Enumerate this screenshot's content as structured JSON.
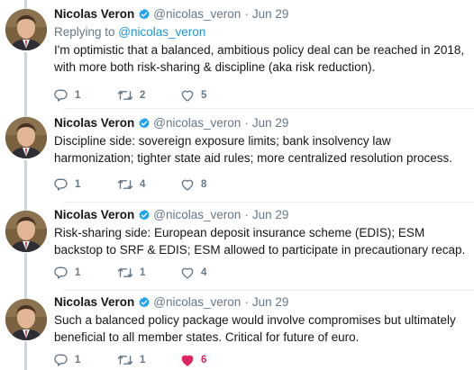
{
  "tweets": [
    {
      "name": "Nicolas Veron",
      "handle": "@nicolas_veron",
      "date": "Jun 29",
      "replying_prefix": "Replying to ",
      "replying_to": "@nicolas_veron",
      "text": "I'm optimistic that a balanced, ambitious policy deal can be reached in 2018, with more both risk-sharing & discipline (aka risk reduction).",
      "replies": "1",
      "retweets": "2",
      "likes": "5",
      "liked": false
    },
    {
      "name": "Nicolas Veron",
      "handle": "@nicolas_veron",
      "date": "Jun 29",
      "text": "Discipline side: sovereign exposure limits; bank insolvency law harmonization; tighter state aid rules; more centralized resolution process.",
      "replies": "1",
      "retweets": "4",
      "likes": "8",
      "liked": false
    },
    {
      "name": "Nicolas Veron",
      "handle": "@nicolas_veron",
      "date": "Jun 29",
      "text": "Risk-sharing side: European deposit insurance scheme (EDIS); ESM backstop to SRF & EDIS; ESM allowed to participate in precautionary recap.",
      "replies": "1",
      "retweets": "1",
      "likes": "4",
      "liked": false
    },
    {
      "name": "Nicolas Veron",
      "handle": "@nicolas_veron",
      "date": "Jun 29",
      "text": "Such a balanced policy package would involve compromises but ultimately beneficial to all member states. Critical for future of euro.",
      "replies": "1",
      "retweets": "1",
      "likes": "6",
      "liked": true
    }
  ],
  "separator": "·",
  "colors": {
    "text": "#14171a",
    "secondary": "#657786",
    "link": "#1b95e0",
    "verified": "#1da1f2",
    "like_active": "#e0245e",
    "thread_line": "#ccd6dd"
  },
  "icons": {
    "verified": "verified-badge-icon",
    "reply": "reply-icon",
    "retweet": "retweet-icon",
    "like": "heart-icon"
  }
}
